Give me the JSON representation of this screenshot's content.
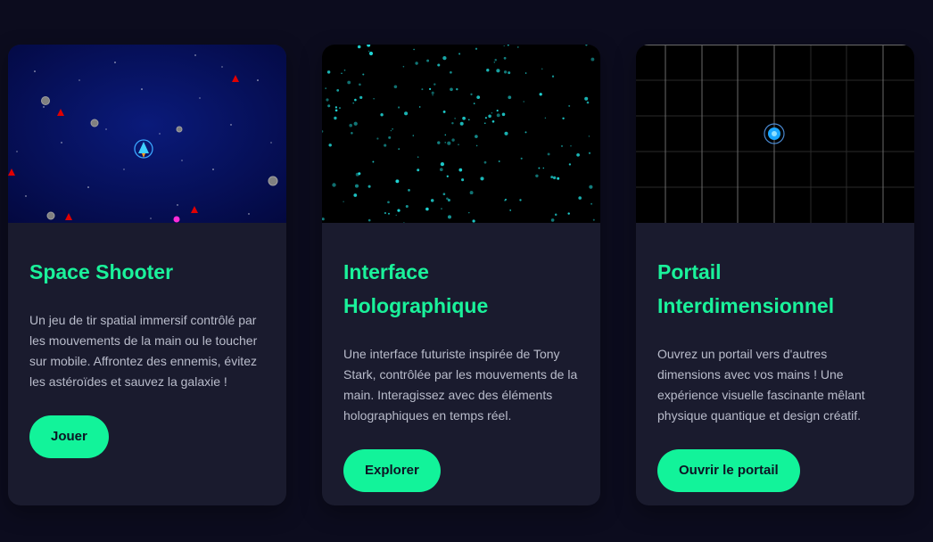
{
  "colors": {
    "page_background": "#0c0c1e",
    "card_background": "#1a1b2e",
    "accent": "#12f39a",
    "body_text": "#b9bccb",
    "button_text": "#0d1424"
  },
  "cards": [
    {
      "title": "Space Shooter",
      "description": "Un jeu de tir spatial immersif contrôlé par les mouvements de la main ou le toucher sur mobile. Affrontez des ennemis, évitez les astéroïdes et sauvez la galaxie !",
      "button_label": "Jouer",
      "visual": "space-shooter-preview"
    },
    {
      "title": "Interface Holographique",
      "description": "Une interface futuriste inspirée de Tony Stark, contrôlée par les mouvements de la main. Interagissez avec des éléments holographiques en temps réel.",
      "button_label": "Explorer",
      "visual": "holographic-particles-preview"
    },
    {
      "title": "Portail Interdimensionnel",
      "description": "Ouvrez un portail vers d'autres dimensions avec vos mains ! Une expérience visuelle fascinante mêlant physique quantique et design créatif.",
      "button_label": "Ouvrir le portail",
      "visual": "portal-grid-preview"
    }
  ]
}
